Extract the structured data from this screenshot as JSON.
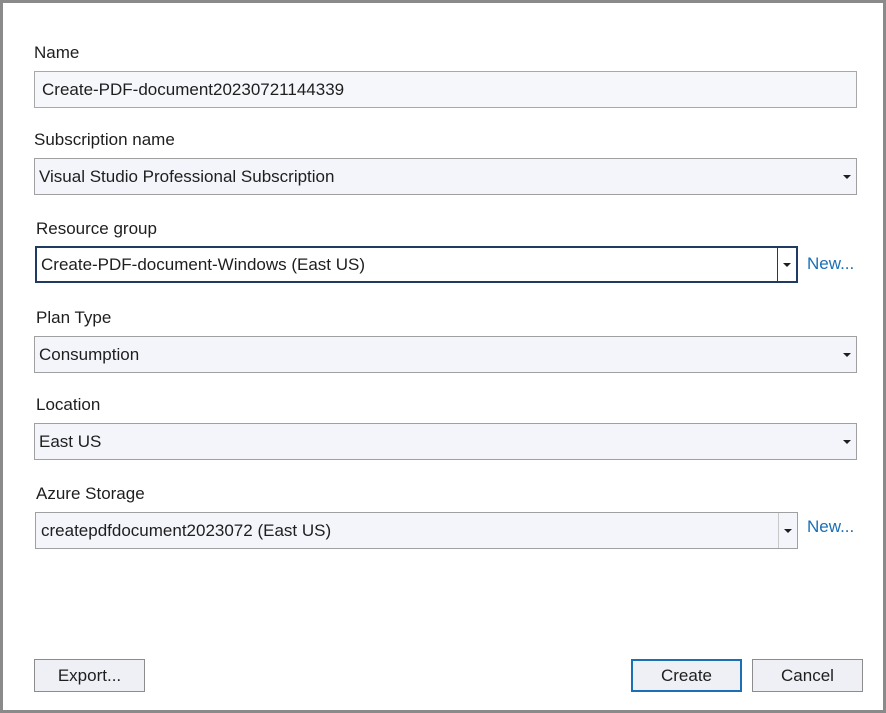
{
  "name": {
    "label": "Name",
    "value": "Create-PDF-document20230721144339"
  },
  "subscription": {
    "label": "Subscription name",
    "value": "Visual Studio Professional Subscription"
  },
  "resource_group": {
    "label": "Resource group",
    "value": "Create-PDF-document-Windows (East US)",
    "new_link": "New..."
  },
  "plan_type": {
    "label": "Plan Type",
    "value": "Consumption"
  },
  "location": {
    "label": "Location",
    "value": "East US"
  },
  "azure_storage": {
    "label": "Azure Storage",
    "value": "createpdfdocument2023072 (East US)",
    "new_link": "New..."
  },
  "buttons": {
    "export": "Export...",
    "create": "Create",
    "cancel": "Cancel"
  },
  "colors": {
    "link": "#1a6fb5",
    "focus_border": "#1f3a63",
    "primary_button_border": "#1a6fb5",
    "field_background": "#f3f5fb"
  }
}
